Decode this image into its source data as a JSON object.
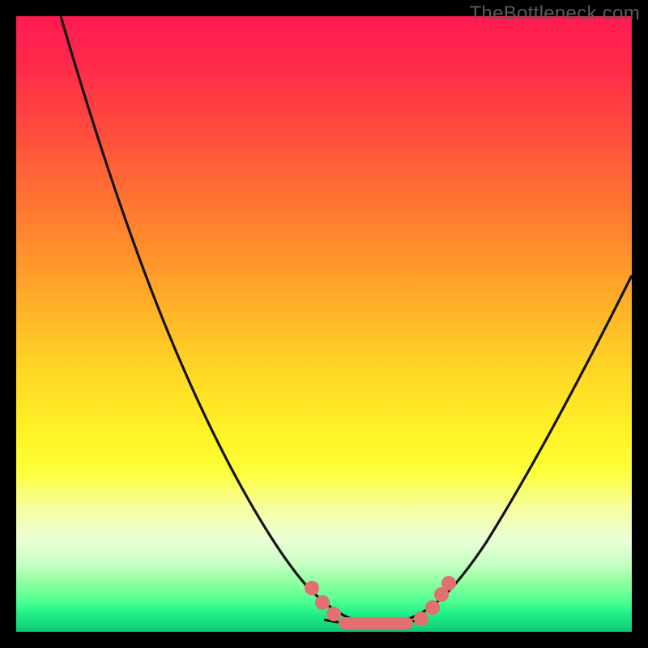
{
  "watermark": "TheBottleneck.com",
  "colors": {
    "frame_bg": "#000000",
    "curve_stroke": "#141414",
    "bead": "#e27070",
    "gradient_top": "#ff1a52",
    "gradient_bottom": "#0fc471"
  },
  "chart_data": {
    "type": "line",
    "title": "",
    "xlabel": "",
    "ylabel": "",
    "xlim": [
      0,
      100
    ],
    "ylim": [
      0,
      100
    ],
    "series": [
      {
        "name": "left-curve",
        "x": [
          7,
          10,
          15,
          20,
          25,
          30,
          35,
          40,
          45,
          48,
          50,
          52,
          55,
          58
        ],
        "y": [
          100,
          90,
          76,
          63,
          51,
          40,
          30,
          21,
          12,
          7,
          4,
          2,
          1,
          0.5
        ]
      },
      {
        "name": "valley-floor",
        "x": [
          50,
          55,
          60,
          65
        ],
        "y": [
          2,
          1,
          1,
          2
        ]
      },
      {
        "name": "right-curve",
        "x": [
          62,
          66,
          70,
          75,
          80,
          85,
          90,
          95,
          100
        ],
        "y": [
          1,
          3,
          6,
          12,
          20,
          29,
          38,
          48,
          58
        ]
      }
    ],
    "markers": {
      "name": "beads",
      "points": [
        {
          "x": 48,
          "y": 7
        },
        {
          "x": 50,
          "y": 4
        },
        {
          "x": 52,
          "y": 2
        },
        {
          "x": 54,
          "y": 1
        },
        {
          "x": 55,
          "y": 0.8
        },
        {
          "x": 57,
          "y": 0.6
        },
        {
          "x": 59,
          "y": 0.6
        },
        {
          "x": 61,
          "y": 0.6
        },
        {
          "x": 63,
          "y": 0.8
        },
        {
          "x": 65,
          "y": 1.2
        },
        {
          "x": 67,
          "y": 3
        },
        {
          "x": 69,
          "y": 5
        },
        {
          "x": 70,
          "y": 7
        }
      ]
    }
  }
}
